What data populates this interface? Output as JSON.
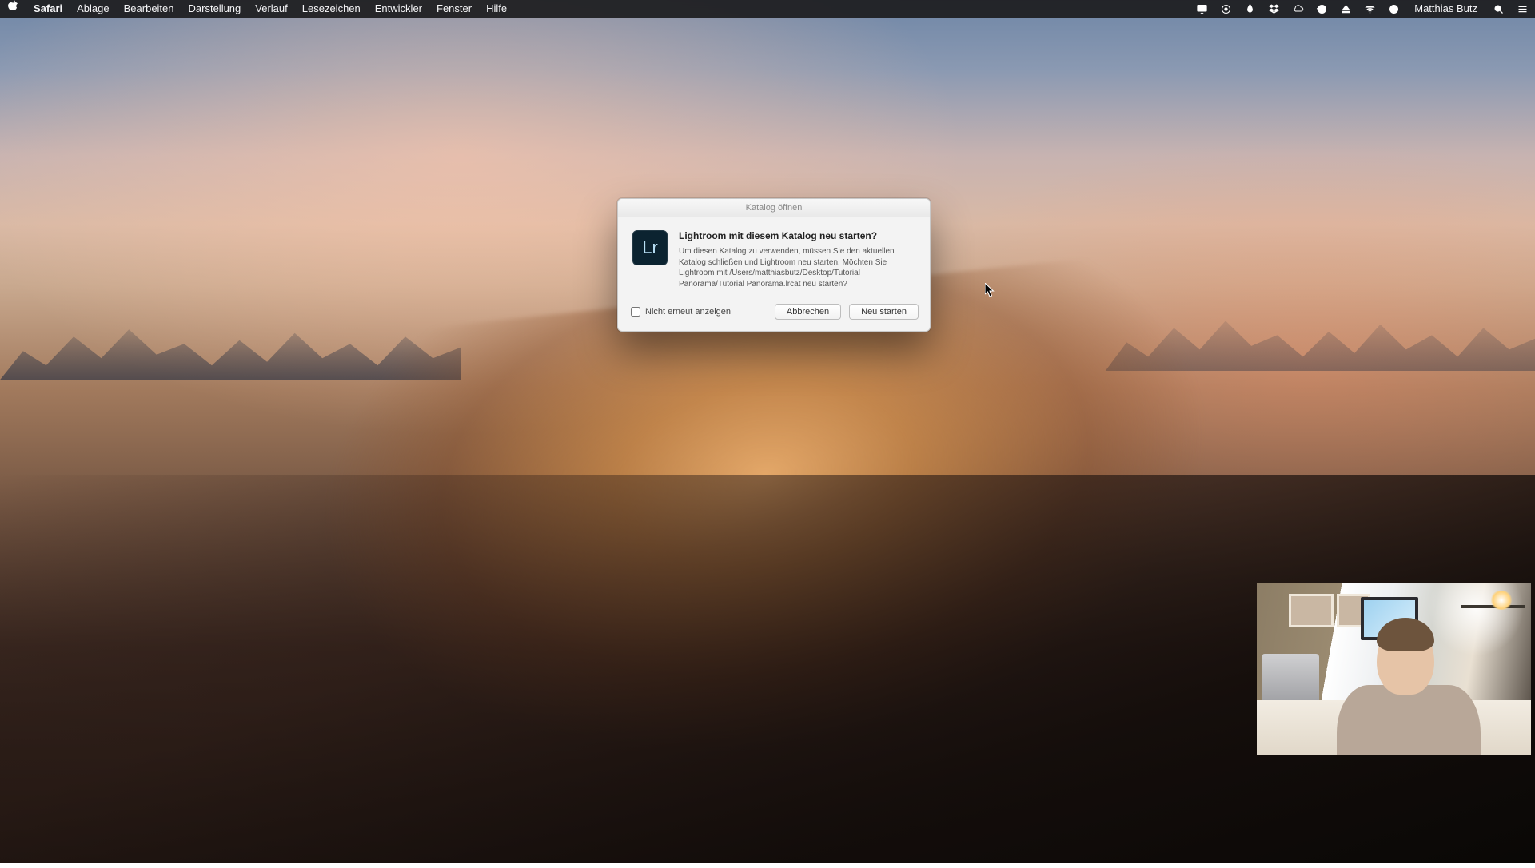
{
  "menubar": {
    "app": "Safari",
    "items": [
      "Ablage",
      "Bearbeiten",
      "Darstellung",
      "Verlauf",
      "Lesezeichen",
      "Entwickler",
      "Fenster",
      "Hilfe"
    ],
    "user": "Matthias Butz"
  },
  "dialog": {
    "title": "Katalog öffnen",
    "icon_label": "Lr",
    "headline": "Lightroom mit diesem Katalog neu starten?",
    "detail": "Um diesen Katalog zu verwenden, müssen Sie den aktuellen Katalog schließen und Lightroom neu starten. Möchten Sie Lightroom mit /Users/matthiasbutz/Desktop/Tutorial Panorama/Tutorial Panorama.lrcat neu starten?",
    "checkbox": "Nicht erneut anzeigen",
    "cancel": "Abbrechen",
    "confirm": "Neu starten"
  }
}
